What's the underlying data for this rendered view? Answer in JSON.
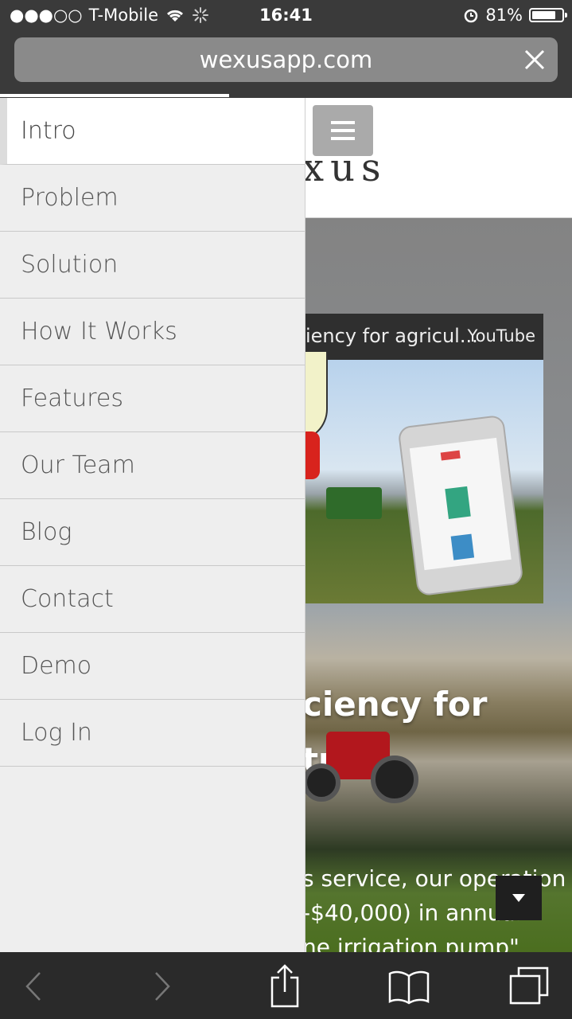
{
  "status_bar": {
    "carrier": "T-Mobile",
    "signal_dots": "●●●○○",
    "time": "16:41",
    "battery_percent": "81%",
    "battery_level": 0.81
  },
  "browser": {
    "url": "wexusapp.com",
    "load_progress": 0.4
  },
  "page": {
    "logo_partial": "xus",
    "video": {
      "title": "iency for agricul...",
      "brand": "YouTube"
    },
    "hero_heading_line1": "ciency for",
    "hero_heading_line2": "ture",
    "hero_quote_line1": "s service, our operation",
    "hero_quote_line2": "-$40,000) in annual",
    "hero_quote_line3": "ne irrigation pump\""
  },
  "menu": {
    "items": [
      {
        "label": "Intro",
        "active": true
      },
      {
        "label": "Problem"
      },
      {
        "label": "Solution"
      },
      {
        "label": "How It Works"
      },
      {
        "label": "Features"
      },
      {
        "label": "Our Team"
      },
      {
        "label": "Blog"
      },
      {
        "label": "Contact"
      },
      {
        "label": "Demo"
      },
      {
        "label": "Log In"
      }
    ]
  },
  "icons": {
    "wifi": "wifi-icon",
    "activity": "loading-spinner-icon",
    "alarm": "alarm-icon",
    "battery": "battery-icon",
    "close": "close-icon",
    "menu": "hamburger-icon",
    "scroll": "caret-down-icon",
    "back": "chevron-left-icon",
    "forward": "chevron-right-icon",
    "share": "share-icon",
    "bookmarks": "bookmarks-icon",
    "tabs": "tabs-icon"
  }
}
